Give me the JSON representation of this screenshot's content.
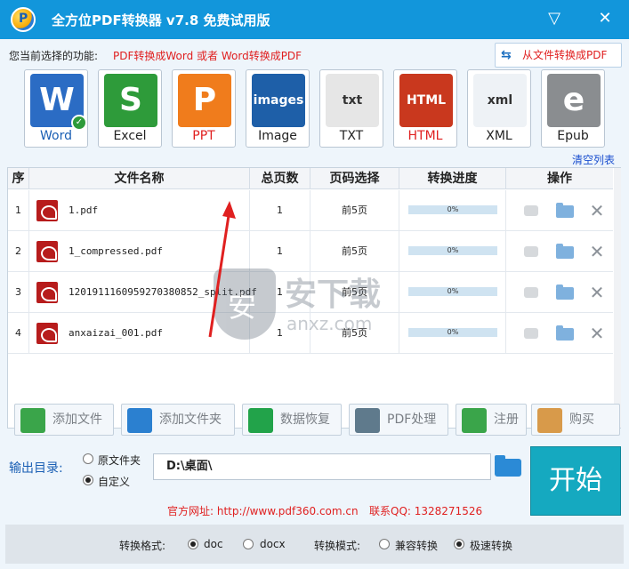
{
  "window": {
    "title": "全方位PDF转换器 v7.8 免费试用版",
    "logo_letter": "P",
    "minimize_glyph": "▽",
    "close_glyph": "✕"
  },
  "function": {
    "label": "您当前选择的功能:",
    "value": "PDF转换成Word 或者 Word转换成PDF",
    "from_file_button": "从文件转换成PDF",
    "from_file_icon": "swap-arrows-icon"
  },
  "formats": [
    {
      "label": "Word",
      "color": "#2b6cc4",
      "icon": "word-icon",
      "glyph": "W",
      "selected": true
    },
    {
      "label": "Excel",
      "color": "#2e9b3a",
      "icon": "excel-icon",
      "glyph": "S",
      "selected": false
    },
    {
      "label": "PPT",
      "color": "#f07c1c",
      "icon": "ppt-icon",
      "glyph": "P",
      "selected": false
    },
    {
      "label": "Image",
      "color": "#1e5fa8",
      "icon": "image-icon",
      "glyph": "images",
      "selected": false
    },
    {
      "label": "TXT",
      "color": "#e6e6e6",
      "icon": "txt-icon",
      "glyph": "txt",
      "selected": false
    },
    {
      "label": "HTML",
      "color": "#c9381e",
      "icon": "html-icon",
      "glyph": "HTML",
      "selected": false
    },
    {
      "label": "XML",
      "color": "#eef2f6",
      "icon": "xml-icon",
      "glyph": "xml",
      "selected": false
    },
    {
      "label": "Epub",
      "color": "#8a8d90",
      "icon": "epub-icon",
      "glyph": "e",
      "selected": false
    }
  ],
  "clear_list": "清空列表",
  "table": {
    "headers": [
      "序",
      "文件名称",
      "总页数",
      "页码选择",
      "转换进度",
      "操作"
    ],
    "rows": [
      {
        "index": "1",
        "name": "1.pdf",
        "pages": "1",
        "range": "前5页",
        "progress": "0%"
      },
      {
        "index": "2",
        "name": "1_compressed.pdf",
        "pages": "1",
        "range": "前5页",
        "progress": "0%"
      },
      {
        "index": "3",
        "name": "1201911160959270380852_split.pdf",
        "pages": "1",
        "range": "前5页",
        "progress": "0%"
      },
      {
        "index": "4",
        "name": "anxaizai_001.pdf",
        "pages": "1",
        "range": "前5页",
        "progress": "0%"
      }
    ]
  },
  "watermark": {
    "shield": "安",
    "text": "安下载",
    "sub": "anxz.com"
  },
  "buttons": [
    {
      "label": "添加文件",
      "icon": "add-file-icon",
      "color": "#3aa54a"
    },
    {
      "label": "添加文件夹",
      "icon": "add-folder-icon",
      "color": "#2b80d0"
    },
    {
      "label": "数据恢复",
      "icon": "data-recovery-icon",
      "color": "#22a34a"
    },
    {
      "label": "PDF处理",
      "icon": "pdf-process-icon",
      "color": "#5f7a8c"
    },
    {
      "label": "注册",
      "icon": "register-check-icon",
      "color": "#3aa54a"
    },
    {
      "label": "购买",
      "icon": "shopping-bag-icon",
      "color": "#d89a4a"
    }
  ],
  "output": {
    "label": "输出目录:",
    "option_original": "原文件夹",
    "option_custom": "自定义",
    "path": "D:\\桌面\\",
    "start": "开始"
  },
  "footer": {
    "site": "官方网址: http://www.pdf360.com.cn",
    "qq": "联系QQ: 1328271526"
  },
  "settings": {
    "format_label": "转换格式:",
    "format_doc": "doc",
    "format_docx": "docx",
    "mode_label": "转换模式:",
    "mode_compat": "兼容转换",
    "mode_fast": "极速转换"
  }
}
